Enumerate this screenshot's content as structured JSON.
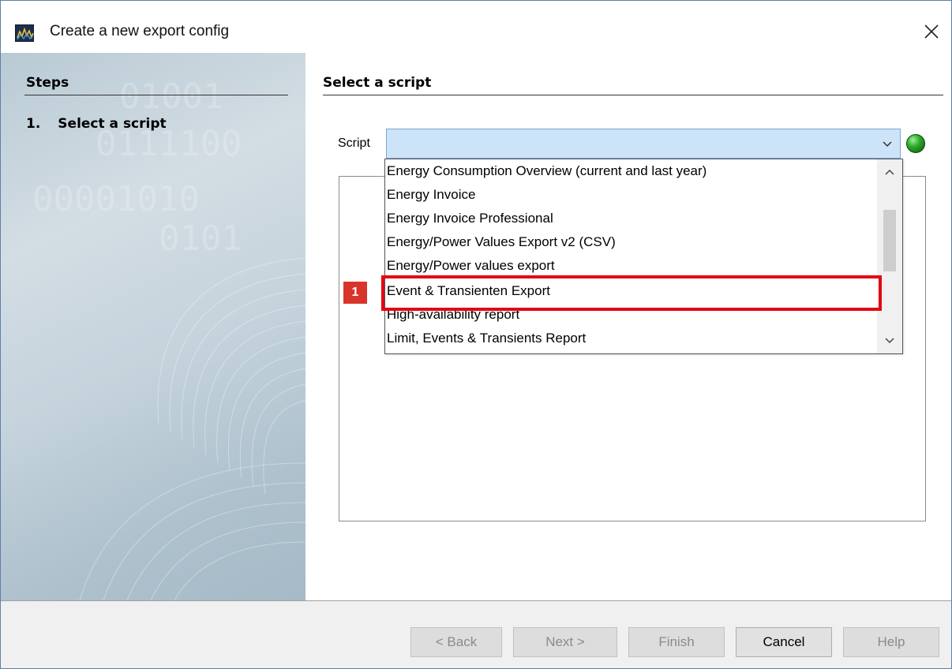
{
  "window": {
    "title": "Create a new export config"
  },
  "sidebar": {
    "heading": "Steps",
    "steps": [
      {
        "number": "1.",
        "label": "Select a script"
      }
    ]
  },
  "content": {
    "heading": "Select a script",
    "script_label": "Script",
    "script_value": "",
    "status_color": "#2eaa2a"
  },
  "dropdown": {
    "items": [
      "Energy Consumption Overview (current and last year)",
      "Energy Invoice",
      "Energy Invoice Professional",
      "Energy/Power Values Export v2 (CSV)",
      "Energy/Power values export",
      "Event & Transienten Export",
      "High-availability report",
      "Limit, Events & Transients Report"
    ],
    "highlighted_index": 5
  },
  "annotation": {
    "badge": "1",
    "color": "#e30613"
  },
  "footer": {
    "back": "< Back",
    "next": "Next >",
    "finish": "Finish",
    "cancel": "Cancel",
    "help": "Help"
  }
}
